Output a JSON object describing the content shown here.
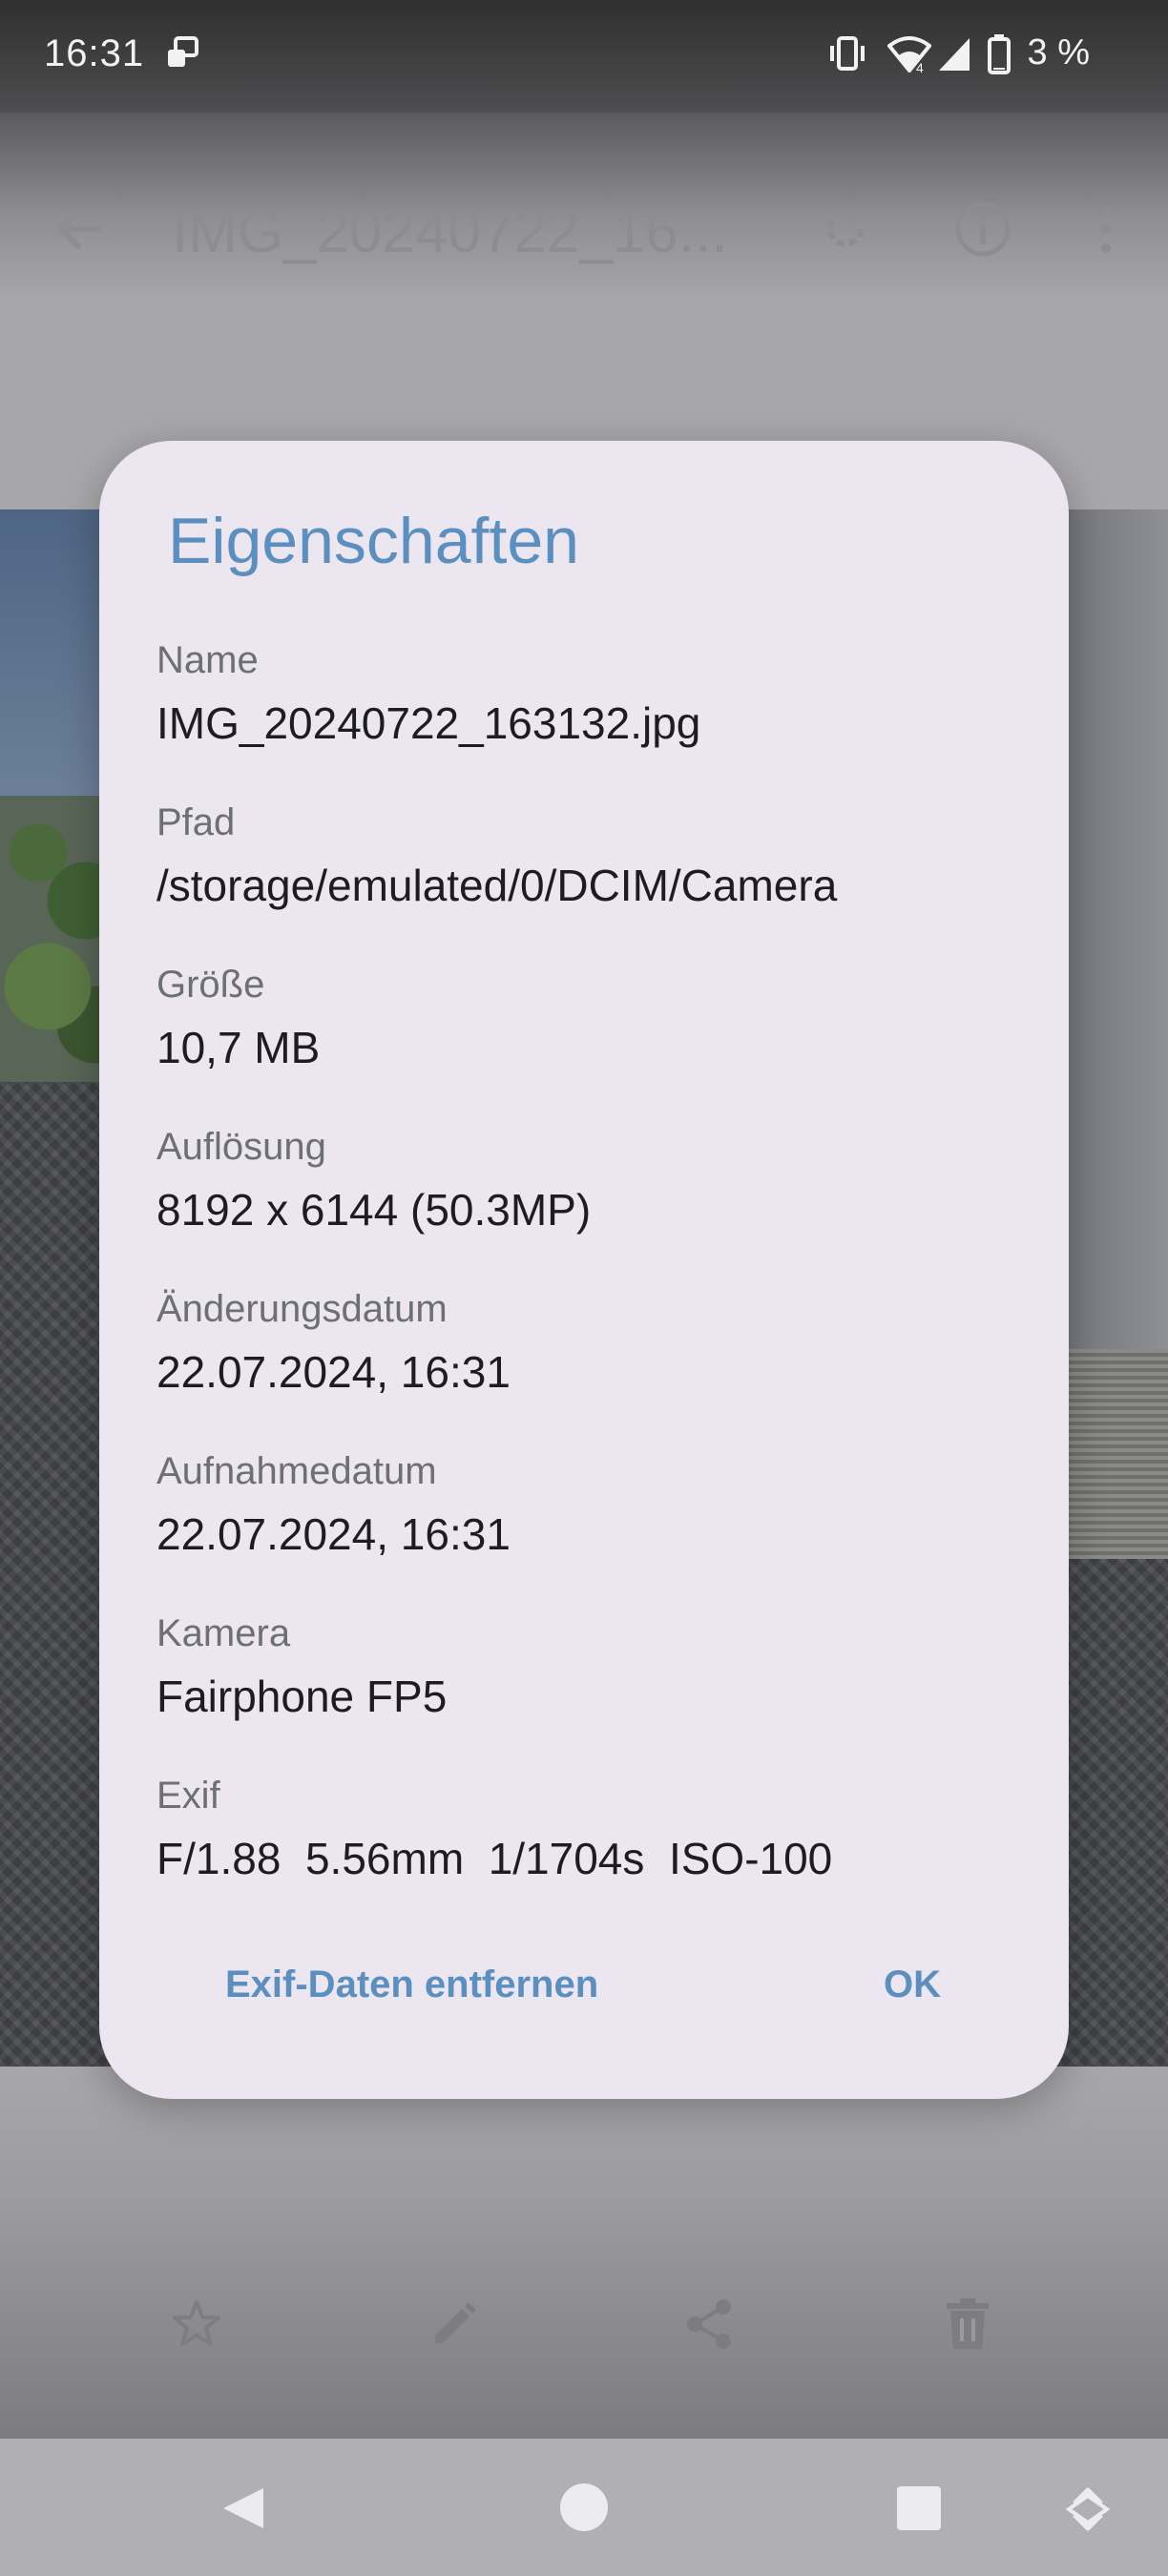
{
  "status_bar": {
    "time": "16:31",
    "battery_percent": "3 %",
    "icons": [
      "screenshot-notification-icon",
      "vibrate-icon",
      "wifi-icon",
      "cell-signal-icon",
      "battery-icon"
    ]
  },
  "app_bar": {
    "title": "IMG_20240722_16...",
    "icons": [
      "back-arrow-icon",
      "rotate-icon",
      "info-icon",
      "more-vert-icon"
    ]
  },
  "dialog": {
    "title": "Eigenschaften",
    "properties": [
      {
        "label": "Name",
        "value": "IMG_20240722_163132.jpg"
      },
      {
        "label": "Pfad",
        "value": "/storage/emulated/0/DCIM/Camera"
      },
      {
        "label": "Größe",
        "value": "10,7 MB"
      },
      {
        "label": "Auflösung",
        "value": "8192 x 6144 (50.3MP)"
      },
      {
        "label": "Änderungsdatum",
        "value": "22.07.2024, 16:31"
      },
      {
        "label": "Aufnahmedatum",
        "value": "22.07.2024, 16:31"
      },
      {
        "label": "Kamera",
        "value": "Fairphone FP5"
      },
      {
        "label": "Exif",
        "value": "F/1.88  5.56mm  1/1704s  ISO-100"
      }
    ],
    "remove_exif_label": "Exif-Daten entfernen",
    "ok_label": "OK"
  },
  "bottom_actions": [
    "star-icon",
    "edit-icon",
    "share-icon",
    "delete-icon"
  ],
  "nav_bar": [
    "back-triangle-icon",
    "home-circle-icon",
    "recents-square-icon",
    "rotate-screen-icon"
  ],
  "colors": {
    "accent": "#5a8fc0",
    "dialog_bg": "#ebe6ef",
    "scrim": "#a7a6a9"
  }
}
